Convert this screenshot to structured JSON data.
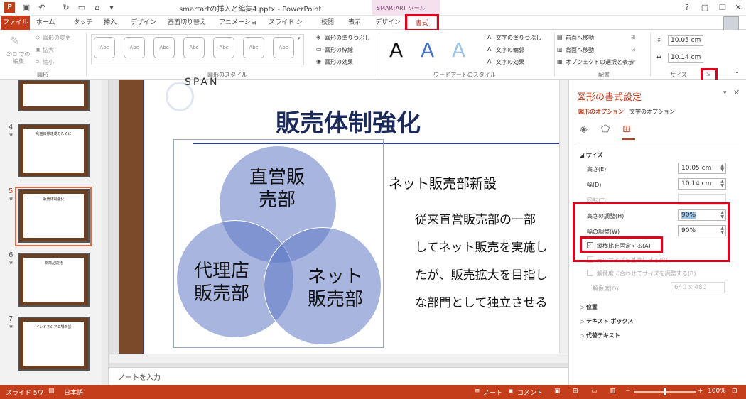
{
  "window": {
    "title": "smartartの挿入と編集4.pptx - PowerPoint",
    "contextual_group": "SMARTART ツール",
    "controls": [
      "?",
      "—",
      "❐",
      "✕"
    ]
  },
  "tabs": [
    "ファイル",
    "ホーム",
    "タッチ",
    "挿入",
    "デザイン",
    "画面切り替え",
    "アニメーション",
    "スライド ショー",
    "校閲",
    "表示",
    "デザイン",
    "書式"
  ],
  "ribbon": {
    "shapes_group": {
      "label": "図形",
      "edit_2d": "2-D での\n編集",
      "change_shape": "図形の変更",
      "enlarge": "拡大",
      "shrink": "縮小"
    },
    "shape_styles_group": {
      "label": "図形のスタイル",
      "swatch_text": "Abc",
      "fill": "図形の塗りつぶし",
      "outline": "図形の枠線",
      "effects": "図形の効果"
    },
    "wordart_group": {
      "label": "ワードアートのスタイル",
      "letter": "A",
      "text_fill": "文字の塗りつぶし",
      "text_outline": "文字の輪郭",
      "text_effects": "文字の効果"
    },
    "arrange_group": {
      "label": "配置",
      "bring_forward": "前面へ移動",
      "send_backward": "背面へ移動",
      "selection_pane": "オブジェクトの選択と表示"
    },
    "size_group": {
      "label": "サイズ",
      "height": "10.05 cm",
      "width": "10.14 cm"
    }
  },
  "thumbnails": [
    {
      "num": "",
      "title": ""
    },
    {
      "num": "4",
      "title": "利益目標達成のために"
    },
    {
      "num": "5",
      "title": "販売体制強化"
    },
    {
      "num": "6",
      "title": "新商品開発"
    },
    {
      "num": "7",
      "title": "インドネシア工場新設"
    }
  ],
  "slide": {
    "logo_text": "SPAN",
    "title": "販売体制強化",
    "venn": [
      "直営販\n売部",
      "代理店\n販売部",
      "ネット\n販売部"
    ],
    "subtitle": "ネット販売部新設",
    "body": [
      "従来直営販売部の一部",
      "してネット販売を実施し",
      "たが、販売拡大を目指し",
      "な部門として独立させる"
    ]
  },
  "notes_placeholder": "ノートを入力",
  "format_pane": {
    "title": "図形の書式設定",
    "tab_shape": "図形のオプション",
    "tab_text": "文字のオプション",
    "size_section": "サイズ",
    "height_label": "高さ(E)",
    "height_value": "10.05 cm",
    "width_label": "幅(D)",
    "width_value": "10.14 cm",
    "rotation_label": "回転(T)",
    "scale_height_label": "高さの調整(H)",
    "scale_height_value": "90%",
    "scale_width_label": "幅の調整(W)",
    "scale_width_value": "90%",
    "lock_aspect_label": "縦横比を固定する(A)",
    "relative_label": "元のサイズを基準にする(R)",
    "best_scale_label": "解像度に合わせてサイズを調整する(B)",
    "resolution_label": "解像度(O)",
    "resolution_value": "640 x 480",
    "position_section": "位置",
    "textbox_section": "テキスト ボックス",
    "alt_text_section": "代替テキスト"
  },
  "status": {
    "slide": "スライド 5/7",
    "language": "日本語",
    "notes": "ノート",
    "comments": "コメント",
    "zoom": "100%"
  },
  "colors": {
    "accent": "#c43e1c",
    "highlight": "#e0001b",
    "venn": "#5e78c4"
  }
}
